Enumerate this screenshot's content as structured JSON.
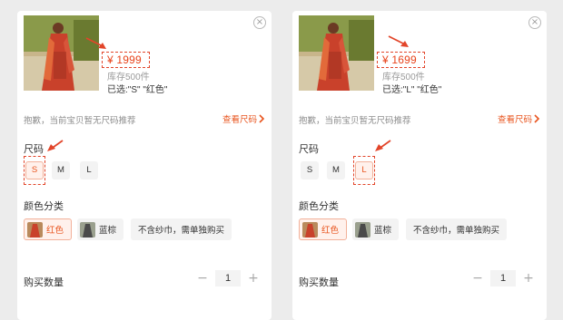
{
  "left_panel": {
    "price": "¥ 1999",
    "stock": "库存500件",
    "selected": "已选:\"S\" \"红色\"",
    "notice": "抱歉，当前宝贝暂无尺码推荐",
    "more_label": "查看尺码",
    "size_title": "尺码",
    "sizes": [
      "S",
      "M",
      "L"
    ],
    "selected_size": "S",
    "color_title": "颜色分类",
    "colors": [
      "红色",
      "蓝棕",
      "不含纱巾，需单独购买"
    ],
    "selected_color": "红色",
    "qty_label": "购买数量",
    "quantity": "1"
  },
  "right_panel": {
    "price": "¥ 1699",
    "stock": "库存500件",
    "selected": "已选:\"L\" \"红色\"",
    "notice": "抱歉，当前宝贝暂无尺码推荐",
    "more_label": "查看尺码",
    "size_title": "尺码",
    "sizes": [
      "S",
      "M",
      "L"
    ],
    "selected_size": "L",
    "color_title": "颜色分类",
    "colors": [
      "红色",
      "蓝棕",
      "不含纱巾，需单独购买"
    ],
    "selected_color": "红色",
    "qty_label": "购买数量",
    "quantity": "1"
  },
  "colors": {
    "accent": "#e8541e",
    "annotation": "#e2452a"
  },
  "icons": {
    "close": "close-icon",
    "more": "chevron-right-icon",
    "minus": "minus-icon",
    "plus": "plus-icon",
    "annotation": "red-arrow-icon"
  }
}
